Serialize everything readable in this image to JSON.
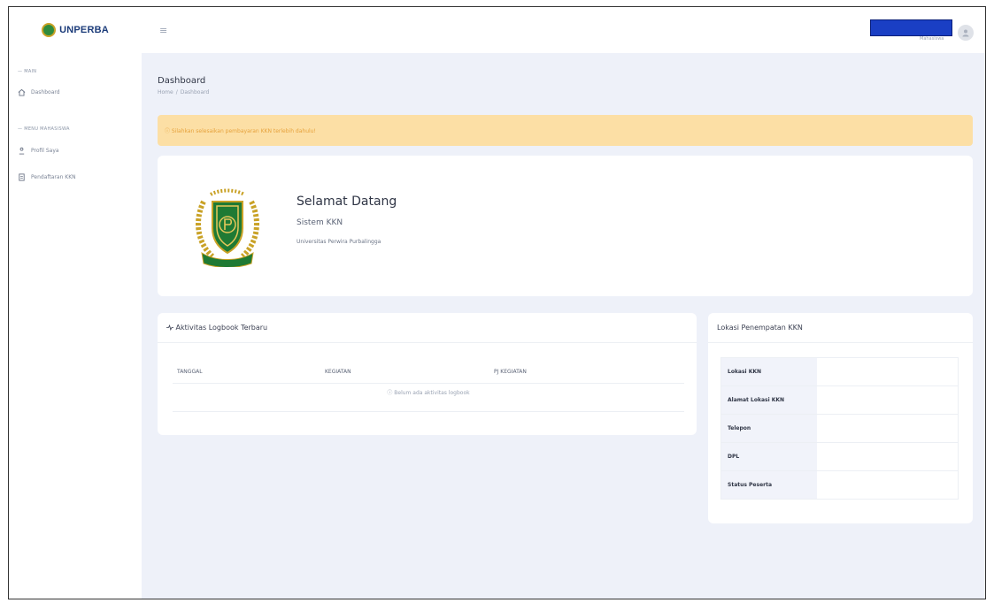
{
  "brand": {
    "name": "UNPERBA"
  },
  "sidebar": {
    "sections": [
      {
        "header": "MAIN",
        "items": [
          {
            "label": "Dashboard",
            "icon": "home-icon"
          }
        ]
      },
      {
        "header": "MENU MAHASISWA",
        "items": [
          {
            "label": "Profil Saya",
            "icon": "user-icon"
          },
          {
            "label": "Pendaftaran KKN",
            "icon": "document-icon"
          }
        ]
      }
    ]
  },
  "topbar": {
    "menu_icon": "hamburger-icon",
    "user_role": "Mahasiswa",
    "avatar_icon": "user-avatar-icon"
  },
  "page": {
    "title": "Dashboard",
    "breadcrumb": [
      "Home",
      "Dashboard"
    ]
  },
  "alert": {
    "text": "ⓘ Silahkan selesaikan pembayaran KKN terlebih dahulu!",
    "color": "#fcdfa5"
  },
  "welcome": {
    "title": "Selamat Datang",
    "subtitle": "Sistem KKN",
    "university": "Universitas Perwira Purbalingga"
  },
  "logbook": {
    "title": "Aktivitas Logbook Terbaru",
    "columns": [
      "TANGGAL",
      "KEGIATAN",
      "PJ KEGIATAN"
    ],
    "empty_text": "ⓘ Belum ada aktivitas logbook"
  },
  "location": {
    "title": "Lokasi Penempatan KKN",
    "rows": [
      {
        "key": "Lokasi KKN",
        "value": ""
      },
      {
        "key": "Alamat Lokasi KKN",
        "value": ""
      },
      {
        "key": "Telepon",
        "value": ""
      },
      {
        "key": "DPL",
        "value": ""
      },
      {
        "key": "Status Peserta",
        "value": ""
      }
    ]
  },
  "colors": {
    "accent": "#1a3fc4",
    "background": "#eef1f9",
    "brand_green": "#2e8b3d"
  }
}
